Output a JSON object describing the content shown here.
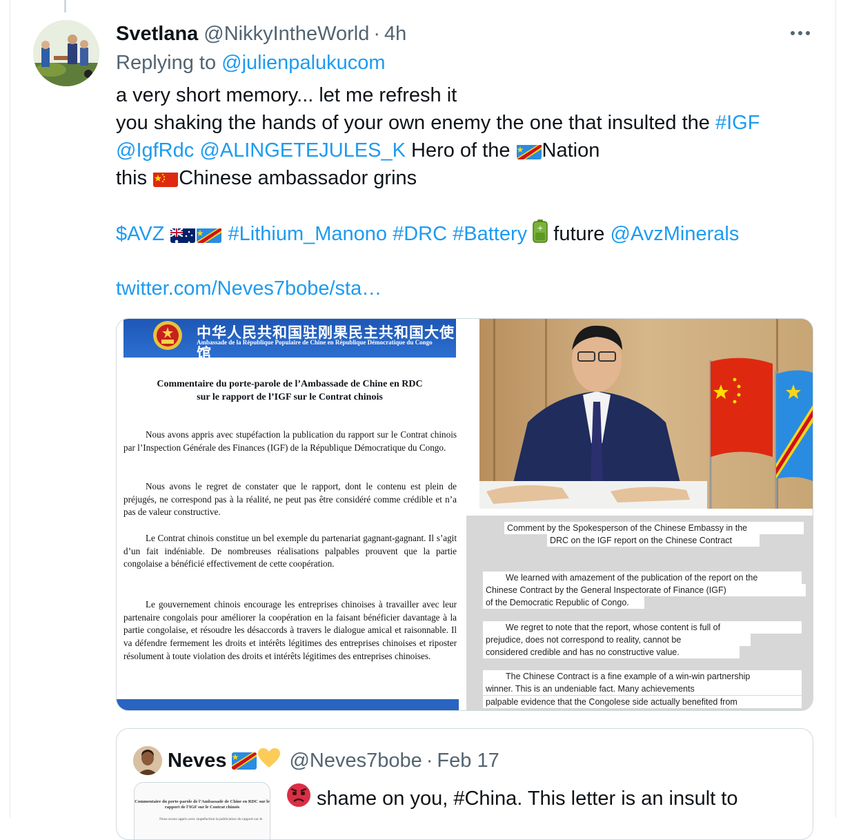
{
  "tweet": {
    "author_name": "Svetlana",
    "author_handle": "@NikkyIntheWorld",
    "separator": "·",
    "time": "4h",
    "replying_label": "Replying to",
    "replying_handle": "@julienpalukucom",
    "text": {
      "line1": "a very short memory... let me refresh it",
      "line2_pre": "you shaking the hands of your own enemy the one that insulted the ",
      "line2_tag": "#IGF",
      "line3_mention1": "@IgfRdc",
      "line3_mention2": "@ALINGETEJULES_K",
      "line3_pre": " Hero of the ",
      "line3_post": "Nation",
      "line4_pre": "this ",
      "line4_post": "Chinese ambassador grins",
      "line6_cashtag": "$AVZ",
      "line6_tags": "#Lithium_Manono #DRC #Battery",
      "line6_word": " future ",
      "line6_mention": "@AvzMinerals",
      "link": "twitter.com/Neves7bobe/sta…"
    }
  },
  "media": {
    "doc": {
      "header_cn": "中华人民共和国驻刚果民主共和国大使馆",
      "header_fr": "Ambassade de la République Populaire de Chine en République Démocratique du Congo",
      "title_l1": "Commentaire du porte-parole de l’Ambassade de Chine en RDC",
      "title_l2": "sur le rapport de l’IGF sur le Contrat chinois",
      "p1": "Nous avons appris avec stupéfaction la publication du rapport sur le Contrat chinois par l’Inspection Générale des Finances (IGF) de la République Démocratique du Congo.",
      "p2": "Nous avons le regret de constater que le rapport, dont le contenu est plein de préjugés, ne correspond pas à la réalité, ne peut pas être considéré comme crédible et n’a pas de valeur constructive.",
      "p3": "Le Contrat chinois constitue un bel exemple du partenariat gagnant-gagnant. Il s’agit d’un fait indéniable. De nombreuses réalisations palpables prouvent que la partie congolaise a bénéficié effectivement de cette coopération.",
      "p4": "Le gouvernement chinois encourage les entreprises chinoises à travailler avec leur partenaire congolais pour améliorer la coopération en la faisant bénéficier davantage à la partie congolaise, et résoudre les désaccords à travers le dialogue amical et raisonnable. Il va défendre fermement les droits et intérêts légitimes des entreprises chinoises et riposter résolument à toute violation des droits et intérêts légitimes des entreprises chinoises."
    },
    "translation": {
      "l1": "Comment by the Spokesperson of the Chinese Embassy in the",
      "l2": "DRC on the IGF report on the Chinese Contract",
      "l3": "We learned with amazement of the publication of the report on the",
      "l4": "Chinese Contract by the General Inspectorate of Finance (IGF)",
      "l5": "of the Democratic Republic of Congo.",
      "l6": "We regret to note that the report, whose content is full of",
      "l7": "prejudice, does not correspond to reality, cannot be",
      "l8": "considered credible and has no constructive value.",
      "l9": "The Chinese Contract is a fine example of a win-win partnership",
      "l10": "winner. This is an undeniable fact. Many achievements",
      "l11": "palpable evidence that the Congolese side actually benefited from"
    }
  },
  "quote": {
    "author_name": "Neves",
    "author_handle": "@Neves7bobe",
    "separator": "·",
    "time": "Feb 17",
    "text": " shame on you, #China. This letter is an insult to",
    "thumb_title": "Commentaire du porte-parole de l’Ambassade de Chine en RDC sur le rapport de l’IGF sur le Contrat chinois",
    "thumb_text": "Nous avons appris avec stupéfaction la publication du rapport sur le"
  },
  "icons": {
    "more": "more-options-icon",
    "flag_drc": "drc-flag-icon",
    "flag_china": "china-flag-icon",
    "flag_australia": "australia-flag-icon",
    "battery": "battery-icon",
    "yellow_heart": "yellow-heart-icon",
    "angry_face": "angry-face-icon"
  },
  "colors": {
    "link": "#1d9bf0",
    "secondary_text": "#536471",
    "primary_text": "#0f1419",
    "border": "#cfd9de"
  }
}
